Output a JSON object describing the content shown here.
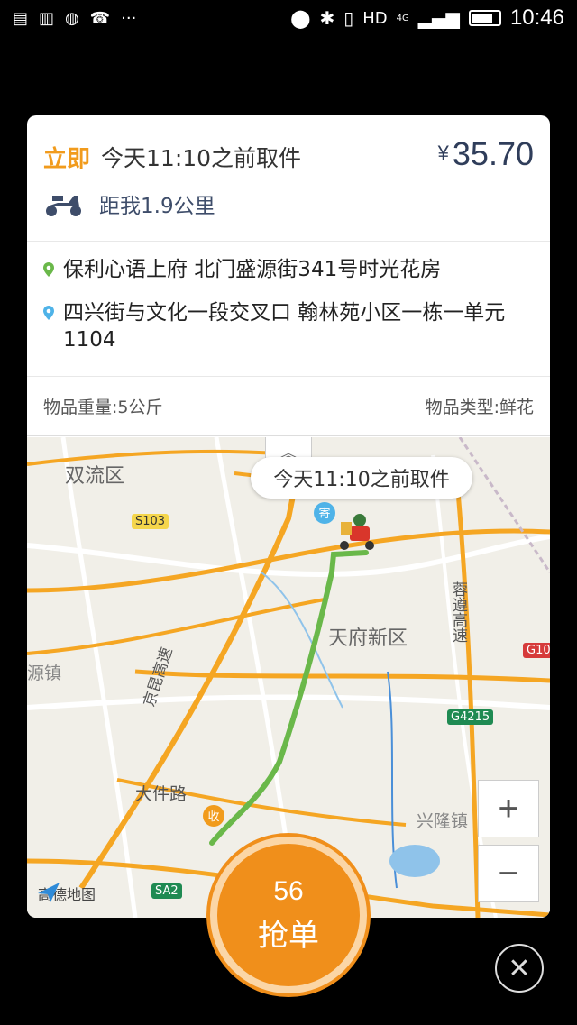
{
  "status_bar": {
    "time": "10:46",
    "network": "HD",
    "signal": "4G",
    "more": "···",
    "icons": [
      "message-icon",
      "sim-icon",
      "wechat-icon",
      "missed-call-icon",
      "location-icon",
      "bluetooth-icon",
      "vibrate-icon",
      "signal-icon",
      "battery-icon"
    ]
  },
  "order": {
    "urgency": "立即",
    "deadline": "今天11:10之前取件",
    "currency": "¥",
    "price": "35.70",
    "distance": "距我1.9公里",
    "pickup_address": "保利心语上府 北门盛源街341号时光花房",
    "dropoff_address": "四兴街与文化一段交叉口 翰林苑小区一栋一单元1104",
    "weight": "物品重量:5公斤",
    "category": "物品类型:鲜花"
  },
  "map": {
    "bubble_text": "今天11:10之前取件",
    "labels": [
      "双流区",
      "天府新区",
      "大件路",
      "兴隆镇",
      "源镇"
    ],
    "highways": [
      "京昆高速",
      "蓉遵高速"
    ],
    "road_signs": [
      "S103",
      "G4215",
      "G10",
      "SA2"
    ],
    "pickup_marker": "寄",
    "dropoff_marker": "收",
    "provider": "高德地图",
    "zoom_in": "+",
    "zoom_out": "−",
    "colors": {
      "route": "#6ab84a",
      "major_road": "#f5a623",
      "water": "#8fc3ea"
    }
  },
  "grab_button": {
    "count": "56",
    "label": "抢单"
  },
  "close_label": "✕"
}
